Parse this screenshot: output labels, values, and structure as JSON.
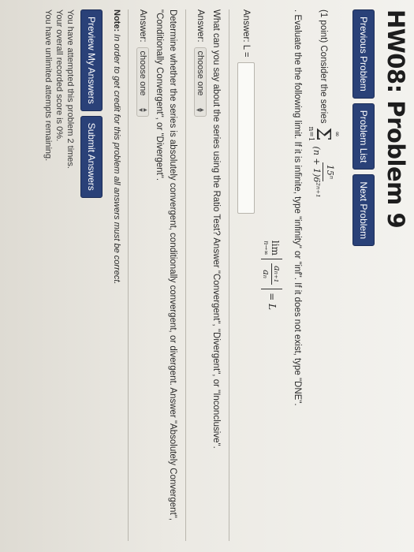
{
  "title": "HW08: Problem 9",
  "nav": {
    "previous": "Previous Problem",
    "list": "Problem List",
    "next": "Next Problem"
  },
  "problem": {
    "intro": "(1 point) Consider the series",
    "sum_upper": "∞",
    "sum_lower": "n=1",
    "term_numerator": "15ⁿ",
    "term_denominator": "(n + 1)6²ⁿ⁺¹",
    "instruction": ". Evaluate the the following limit. If it is infinite, type \"infinity\" or \"inf\". If it does not exist, type \"DNE\".",
    "limit_word": "lim",
    "limit_sub": "n→∞",
    "limit_num": "aₙ₊₁",
    "limit_den": "aₙ",
    "limit_rhs": "= L",
    "answer_label": "Answer: L =",
    "ratio_question": "What can you say about the series using the Ratio Test? Answer \"Convergent\", \"Divergent\", or \"Inconclusive\".",
    "answer_prefix": "Answer:",
    "select_placeholder_1": "choose one",
    "abs_question": "Determine whether the series is absolutely convergent, conditionally convergent, or divergent. Answer \"Absolutely Convergent\", \"Conditionally Convergent\", or \"Divergent\".",
    "select_placeholder_2": "choose one"
  },
  "note": {
    "label": "Note:",
    "text": " In order to get credit for this problem all answers must be correct."
  },
  "buttons": {
    "preview": "Preview My Answers",
    "submit": "Submit Answers"
  },
  "status": {
    "attempts": "You have attempted this problem 2 times.",
    "score": "Your overall recorded score is 0%.",
    "remaining": "You have unlimited attempts remaining."
  },
  "colors": {
    "button_bg": "#2a4178",
    "button_text": "#ffffff"
  }
}
